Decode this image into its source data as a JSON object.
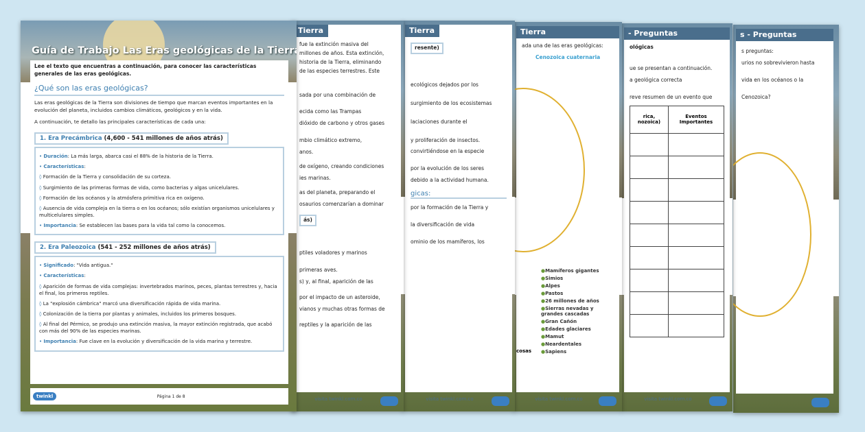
{
  "front": {
    "title": "Guía de Trabajo  Las Eras geológicas de la Tierra",
    "intro": "Lee el texto que encuentras a continuación, para conocer las características generales de las eras geológicas.",
    "section_title": "¿Qué son las eras geológicas?",
    "section_body": "Las eras geológicas de la Tierra son divisiones de tiempo que marcan eventos importantes en la evolución del planeta, incluidos cambios climáticos, geológicos y en la vida.",
    "intro2": "A continuación, te detallo las principales características de cada una:",
    "era1": {
      "num": "1.  Era Precámbrica",
      "range": "(4,600 - 541 millones de años atrás)",
      "duration_k": "Duración",
      "duration_v": ": La más larga, abarca casi el 88% de la historia de la Tierra.",
      "char_k": "Características",
      "items": [
        "Formación de la Tierra y consolidación de su corteza.",
        "Surgimiento de las primeras formas de vida, como bacterias y algas unicelulares.",
        "Formación de los océanos y la atmósfera primitiva rica en oxígeno.",
        "Ausencia de vida compleja en la tierra o en los océanos; sólo existían organismos unicelulares y multicelulares simples."
      ],
      "imp_k": "Importancia",
      "imp_v": ": Se establecen las bases para la vida tal como la conocemos."
    },
    "era2": {
      "num": "2.  Era Paleozoica",
      "range": "(541 - 252 millones de años atrás)",
      "sig_k": "Significado",
      "sig_v": ": \"Vida antigua.\"",
      "char_k": "Características",
      "items": [
        "Aparición de formas de vida complejas: invertebrados marinos, peces, plantas terrestres y, hacia el final, los primeros reptiles.",
        "La \"explosión cámbrica\" marcó una diversificación rápida de vida marina.",
        "Colonización de la tierra por plantas y animales, incluidos los primeros bosques.",
        "Al final del Pérmico, se produjo una extinción masiva, la mayor extinción registrada, que acabó con más del 90% de las especies marinas."
      ],
      "imp_k": "Importancia",
      "imp_v": ": Fue clave en la evolución y diversificación de la vida marina y terrestre."
    },
    "footer_page": "Página 1 de 8",
    "logo": "twinkl"
  },
  "pages": {
    "p2_hdr": "Tierra",
    "p2_lines": [
      "fue la extinción masiva del",
      "millones de años. Esta extinción,",
      "historia de la Tierra, eliminando",
      "de las especies terrestres. Este",
      "sada por una combinación de",
      "ecida como las Trampas",
      "dióxido de carbono y otros gases",
      "mbio climático extremo,",
      "anos.",
      "de oxígeno, creando condiciones",
      "ies marinas.",
      "as del planeta, preparando el",
      "osaurios comenzarían a dominar",
      "ás)",
      "ptiles voladores y marinos",
      "primeras aves.",
      "s) y, al final, aparición de las",
      "por el impacto de un asteroide,",
      "vianos y muchas otras formas de",
      "reptiles y la aparición de las"
    ],
    "p3_hdr": "Tierra",
    "p3_lines": [
      "resente)",
      "ecológicos dejados por los",
      "surgimiento de los ecosistemas",
      "laciaciones durante el",
      "y proliferación de insectos.",
      "convirtiéndose en la especie",
      "por la evolución de los seres",
      "debido a la actividad humana.",
      "gicas:",
      "por la formación de la Tierra y",
      "la diversificación de vida",
      "ominio de los mamíferos, los"
    ],
    "p4_hdr": "Tierra",
    "p4_line": "ada una de las eras geológicas:",
    "p4_item": "Cenozoica cuaternaria",
    "p4_legend": [
      "Mamíferos gigantes",
      "Simios",
      "Alpes",
      "Pastos",
      "26 millones de años",
      "Sierras nevadas y grandes cascadas",
      "Gran Cañón",
      "Edades glaciares",
      "Mamut",
      "Neardentales",
      "Sapiens"
    ],
    "p4_frag": "cosas",
    "p5_hdr": "- Preguntas",
    "p5_lines": [
      "ológicas",
      "ue se presentan a continuación.",
      "a geológica correcta",
      "reve resumen de un evento que"
    ],
    "p5_th1": "rica, nozoica)",
    "p5_th2": "Eventos Importantes",
    "p6_hdr": "s - Preguntas",
    "p6_lines": [
      "s preguntas:",
      "urios no sobrevivieron hasta",
      "vida en los océanos o la",
      "Cenozoica?"
    ],
    "footer_site": "visita twinkl.com.co"
  }
}
